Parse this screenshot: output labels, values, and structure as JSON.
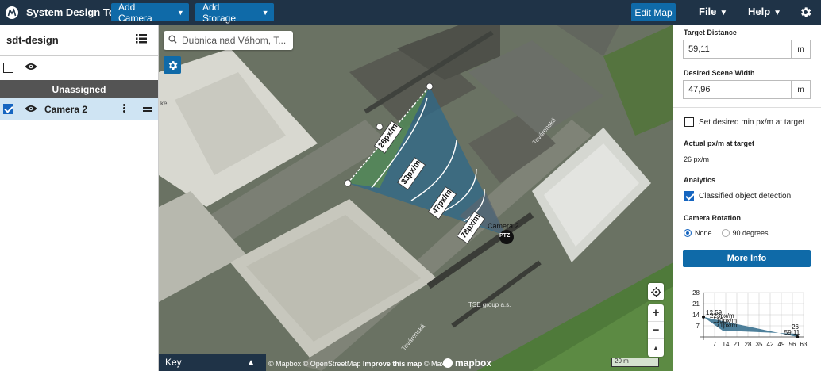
{
  "app": {
    "title": "System Design Tool",
    "add_camera": "Add Camera",
    "add_storage": "Add Storage",
    "edit_map": "Edit Map",
    "file_menu": "File",
    "help_menu": "Help"
  },
  "sidebar": {
    "project": "sdt-design",
    "group": "Unassigned",
    "cameras": [
      {
        "name": "Camera 2",
        "checked": true
      }
    ]
  },
  "map": {
    "search_value": "Dubnica nad Váhom, T...",
    "camera_label": "Camera 2",
    "camera_badge": "PTZ",
    "fov_labels": [
      "26px/m",
      "33px/m",
      "47px/m",
      "78px/m"
    ],
    "street_labels": [
      "Továrenská",
      "Továrenská",
      "TSE group a.s."
    ],
    "edge_text": "ke",
    "key_label": "Key",
    "attrib_mapbox": "© Mapbox",
    "attrib_osm": "© OpenStreetMap",
    "attrib_improve": "Improve this map",
    "attrib_maxar": "© Maxar",
    "mapbox": "mapbox",
    "scale": "20 m"
  },
  "panel": {
    "target_distance_label": "Target Distance",
    "target_distance": "59,11",
    "target_distance_unit": "m",
    "scene_width_label": "Desired Scene Width",
    "scene_width": "47,96",
    "scene_width_unit": "m",
    "min_pxm_label": "Set desired min px/m at target",
    "actual_label": "Actual px/m at target",
    "actual_value": "26 px/m",
    "analytics_label": "Analytics",
    "classified_label": "Classified object detection",
    "rotation_label": "Camera Rotation",
    "rot_none": "None",
    "rot_90": "90 degrees",
    "more_info": "More Info"
  },
  "chart_data": {
    "type": "area",
    "x_ticks": [
      7,
      14,
      21,
      28,
      35,
      42,
      49,
      56,
      63
    ],
    "y_ticks": [
      28,
      21,
      14,
      7
    ],
    "xlim": [
      0,
      63
    ],
    "ylim": [
      0,
      28
    ],
    "points": [
      {
        "x": 0,
        "y": 12.59,
        "label": "12.59"
      },
      {
        "x": 59.11,
        "y": 0,
        "label": "59.11"
      }
    ],
    "labels": [
      "223px/m",
      "110px/m",
      "71px/m",
      "26"
    ],
    "grid": true
  }
}
